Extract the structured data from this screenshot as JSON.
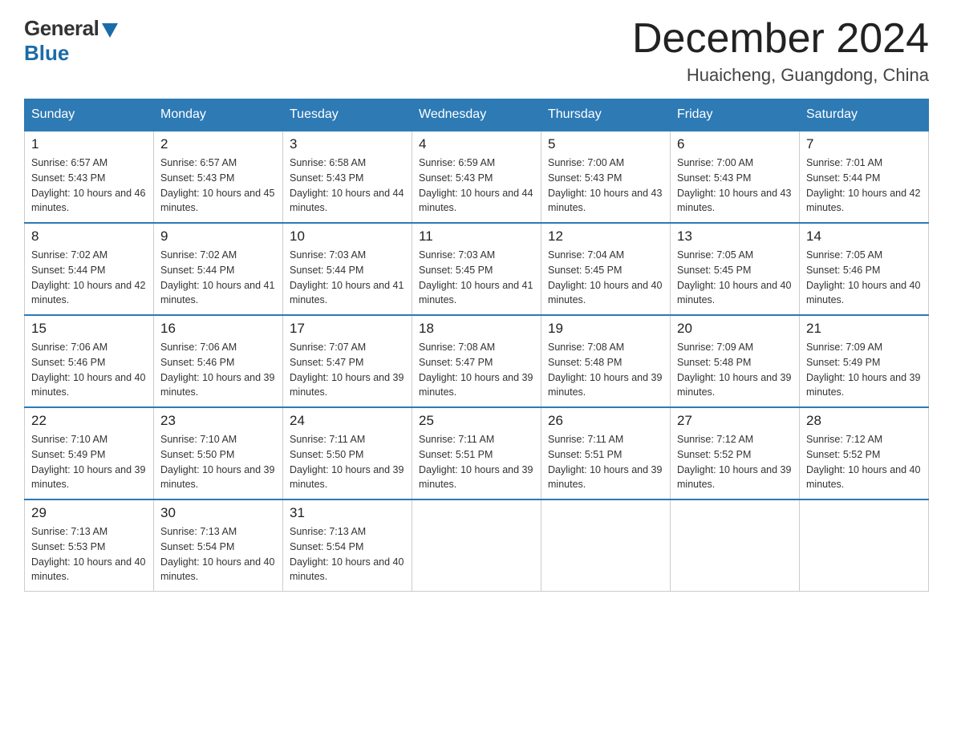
{
  "logo": {
    "general": "General",
    "blue": "Blue"
  },
  "title": "December 2024",
  "location": "Huaicheng, Guangdong, China",
  "days_of_week": [
    "Sunday",
    "Monday",
    "Tuesday",
    "Wednesday",
    "Thursday",
    "Friday",
    "Saturday"
  ],
  "weeks": [
    [
      {
        "day": "1",
        "sunrise": "6:57 AM",
        "sunset": "5:43 PM",
        "daylight": "10 hours and 46 minutes."
      },
      {
        "day": "2",
        "sunrise": "6:57 AM",
        "sunset": "5:43 PM",
        "daylight": "10 hours and 45 minutes."
      },
      {
        "day": "3",
        "sunrise": "6:58 AM",
        "sunset": "5:43 PM",
        "daylight": "10 hours and 44 minutes."
      },
      {
        "day": "4",
        "sunrise": "6:59 AM",
        "sunset": "5:43 PM",
        "daylight": "10 hours and 44 minutes."
      },
      {
        "day": "5",
        "sunrise": "7:00 AM",
        "sunset": "5:43 PM",
        "daylight": "10 hours and 43 minutes."
      },
      {
        "day": "6",
        "sunrise": "7:00 AM",
        "sunset": "5:43 PM",
        "daylight": "10 hours and 43 minutes."
      },
      {
        "day": "7",
        "sunrise": "7:01 AM",
        "sunset": "5:44 PM",
        "daylight": "10 hours and 42 minutes."
      }
    ],
    [
      {
        "day": "8",
        "sunrise": "7:02 AM",
        "sunset": "5:44 PM",
        "daylight": "10 hours and 42 minutes."
      },
      {
        "day": "9",
        "sunrise": "7:02 AM",
        "sunset": "5:44 PM",
        "daylight": "10 hours and 41 minutes."
      },
      {
        "day": "10",
        "sunrise": "7:03 AM",
        "sunset": "5:44 PM",
        "daylight": "10 hours and 41 minutes."
      },
      {
        "day": "11",
        "sunrise": "7:03 AM",
        "sunset": "5:45 PM",
        "daylight": "10 hours and 41 minutes."
      },
      {
        "day": "12",
        "sunrise": "7:04 AM",
        "sunset": "5:45 PM",
        "daylight": "10 hours and 40 minutes."
      },
      {
        "day": "13",
        "sunrise": "7:05 AM",
        "sunset": "5:45 PM",
        "daylight": "10 hours and 40 minutes."
      },
      {
        "day": "14",
        "sunrise": "7:05 AM",
        "sunset": "5:46 PM",
        "daylight": "10 hours and 40 minutes."
      }
    ],
    [
      {
        "day": "15",
        "sunrise": "7:06 AM",
        "sunset": "5:46 PM",
        "daylight": "10 hours and 40 minutes."
      },
      {
        "day": "16",
        "sunrise": "7:06 AM",
        "sunset": "5:46 PM",
        "daylight": "10 hours and 39 minutes."
      },
      {
        "day": "17",
        "sunrise": "7:07 AM",
        "sunset": "5:47 PM",
        "daylight": "10 hours and 39 minutes."
      },
      {
        "day": "18",
        "sunrise": "7:08 AM",
        "sunset": "5:47 PM",
        "daylight": "10 hours and 39 minutes."
      },
      {
        "day": "19",
        "sunrise": "7:08 AM",
        "sunset": "5:48 PM",
        "daylight": "10 hours and 39 minutes."
      },
      {
        "day": "20",
        "sunrise": "7:09 AM",
        "sunset": "5:48 PM",
        "daylight": "10 hours and 39 minutes."
      },
      {
        "day": "21",
        "sunrise": "7:09 AM",
        "sunset": "5:49 PM",
        "daylight": "10 hours and 39 minutes."
      }
    ],
    [
      {
        "day": "22",
        "sunrise": "7:10 AM",
        "sunset": "5:49 PM",
        "daylight": "10 hours and 39 minutes."
      },
      {
        "day": "23",
        "sunrise": "7:10 AM",
        "sunset": "5:50 PM",
        "daylight": "10 hours and 39 minutes."
      },
      {
        "day": "24",
        "sunrise": "7:11 AM",
        "sunset": "5:50 PM",
        "daylight": "10 hours and 39 minutes."
      },
      {
        "day": "25",
        "sunrise": "7:11 AM",
        "sunset": "5:51 PM",
        "daylight": "10 hours and 39 minutes."
      },
      {
        "day": "26",
        "sunrise": "7:11 AM",
        "sunset": "5:51 PM",
        "daylight": "10 hours and 39 minutes."
      },
      {
        "day": "27",
        "sunrise": "7:12 AM",
        "sunset": "5:52 PM",
        "daylight": "10 hours and 39 minutes."
      },
      {
        "day": "28",
        "sunrise": "7:12 AM",
        "sunset": "5:52 PM",
        "daylight": "10 hours and 40 minutes."
      }
    ],
    [
      {
        "day": "29",
        "sunrise": "7:13 AM",
        "sunset": "5:53 PM",
        "daylight": "10 hours and 40 minutes."
      },
      {
        "day": "30",
        "sunrise": "7:13 AM",
        "sunset": "5:54 PM",
        "daylight": "10 hours and 40 minutes."
      },
      {
        "day": "31",
        "sunrise": "7:13 AM",
        "sunset": "5:54 PM",
        "daylight": "10 hours and 40 minutes."
      },
      null,
      null,
      null,
      null
    ]
  ],
  "labels": {
    "sunrise_prefix": "Sunrise: ",
    "sunset_prefix": "Sunset: ",
    "daylight_prefix": "Daylight: "
  }
}
